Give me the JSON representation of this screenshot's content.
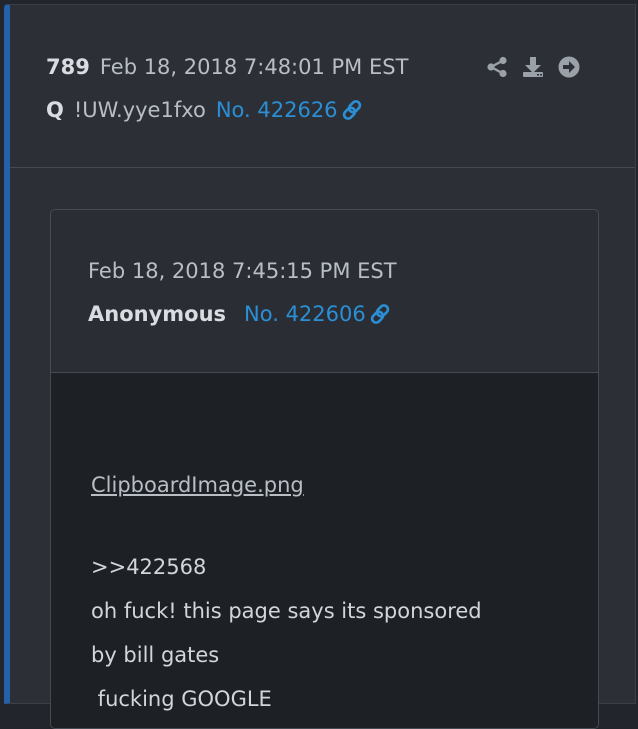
{
  "post": {
    "number": "789",
    "timestamp": "Feb 18, 2018 7:48:01 PM EST",
    "author": "Q",
    "tripcode": "!UW.yye1fxo",
    "post_id": "No. 422626",
    "actions": [
      "share-icon",
      "download-icon",
      "arrow-circle-right-icon"
    ],
    "accent_color": "#2361a8",
    "link_color": "#2b8fd6"
  },
  "quoted_post": {
    "timestamp": "Feb 18, 2018 7:45:15 PM EST",
    "author": "Anonymous",
    "post_id": "No. 422606",
    "attachment": "ClipboardImage.png",
    "lines": [
      ">>422568",
      "oh fuck! this page says its sponsored",
      "by bill gates",
      " fucking GOOGLE"
    ]
  }
}
